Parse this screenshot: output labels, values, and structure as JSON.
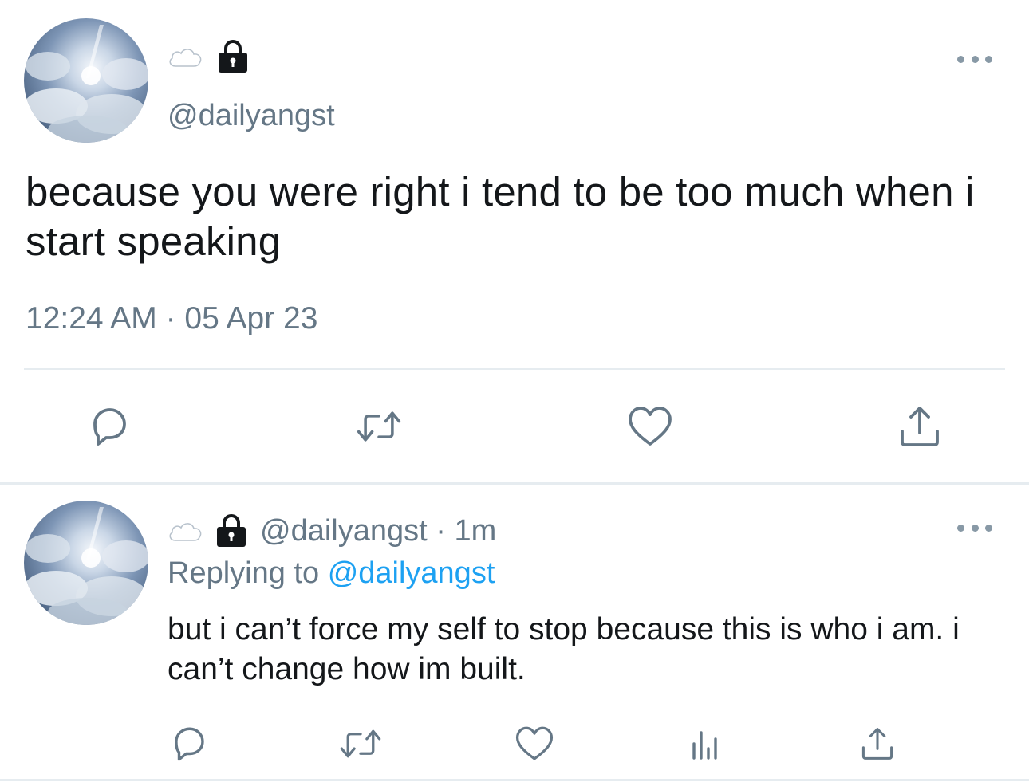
{
  "colors": {
    "text_primary": "#14171a",
    "text_secondary": "#657786",
    "link": "#1da1f2",
    "divider": "#e6ecf0",
    "icon": "#657786"
  },
  "main_tweet": {
    "name_emoji": "cloud-emoji",
    "lock_icon": "lock-icon",
    "handle": "@dailyangst",
    "text": "because you were right i tend to be too much when i start speaking",
    "timestamp": "12:24 AM · 05 Apr 23",
    "actions": [
      "reply-icon",
      "retweet-icon",
      "like-icon",
      "share-icon"
    ]
  },
  "reply_tweet": {
    "name_emoji": "cloud-emoji",
    "lock_icon": "lock-icon",
    "handle_time": "@dailyangst · 1m",
    "replying_prefix": "Replying to",
    "replying_handle": "@dailyangst",
    "text": "but i can’t force my self to stop because this is who i am. i can’t change how im built.",
    "actions": [
      "reply-icon",
      "retweet-icon",
      "like-icon",
      "analytics-icon",
      "share-icon"
    ]
  }
}
